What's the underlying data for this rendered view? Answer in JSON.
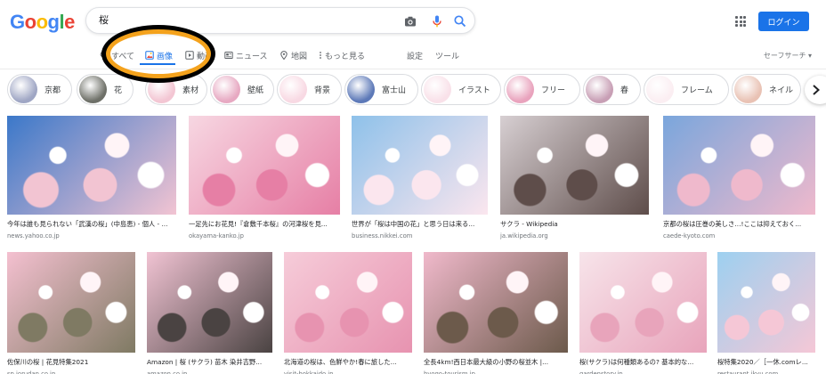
{
  "logo": {
    "letters": [
      "G",
      "o",
      "o",
      "g",
      "l",
      "e"
    ],
    "colors": [
      "#4285f4",
      "#ea4335",
      "#fbbc05",
      "#4285f4",
      "#34a853",
      "#ea4335"
    ]
  },
  "search": {
    "query": "桜"
  },
  "header": {
    "login_label": "ログイン"
  },
  "tabs": [
    {
      "label": "すべて",
      "icon": "search-icon"
    },
    {
      "label": "画像",
      "icon": "image-icon",
      "active": true
    },
    {
      "label": "動画",
      "icon": "video-icon"
    },
    {
      "label": "ニュース",
      "icon": "news-icon"
    },
    {
      "label": "地図",
      "icon": "map-pin-icon"
    },
    {
      "label": "もっと見る",
      "icon": "more-icon"
    },
    {
      "label": "設定"
    },
    {
      "label": "ツール"
    }
  ],
  "safe_search": "セーフサーチ ▾",
  "chips": [
    {
      "label": "京都",
      "thumb": "#9fa6c4"
    },
    {
      "label": "花",
      "thumb": "#6e7068"
    },
    {
      "label": "素材",
      "thumb": "#f3c6d3"
    },
    {
      "label": "壁紙",
      "thumb": "#e7a9c2"
    },
    {
      "label": "背景",
      "thumb": "#f8d9e3"
    },
    {
      "label": "富士山",
      "thumb": "#5d79b8"
    },
    {
      "label": "イラスト",
      "thumb": "#f9e1e9"
    },
    {
      "label": "フリー",
      "thumb": "#e9a3bd"
    },
    {
      "label": "春",
      "thumb": "#c89fb5"
    },
    {
      "label": "フレーム",
      "thumb": "#fbeef2"
    },
    {
      "label": "ネイル",
      "thumb": "#e9c2b4"
    }
  ],
  "results": [
    {
      "title": "今年は誰も見られない「武漢の桜」(中島恵) - 個人 - ...",
      "source": "news.yahoo.co.jp",
      "colors": [
        "#3b78c9",
        "#f2c4d2"
      ]
    },
    {
      "title": "一足先にお花見!『倉敷千本桜』の河津桜を見...",
      "source": "okayama-kanko.jp",
      "colors": [
        "#f7d7e2",
        "#e67fa5"
      ]
    },
    {
      "title": "世界が「桜は中国の花」と思う日は来る...",
      "source": "business.nikkei.com",
      "colors": [
        "#8ec1ea",
        "#fbe6ee"
      ]
    },
    {
      "title": "サクラ - Wikipedia",
      "source": "ja.wikipedia.org",
      "colors": [
        "#d7cfd2",
        "#5e4d4a"
      ]
    },
    {
      "title": "京都の桜は圧巻の美しさ…!ここは抑えておく...",
      "source": "caede-kyoto.com",
      "colors": [
        "#7aa6dc",
        "#efb9cc"
      ]
    },
    {
      "title": "佐保川の桜 | 花見特集2021",
      "source": "sp.jorudan.co.jp",
      "colors": [
        "#f4c0d0",
        "#7f7a63"
      ]
    },
    {
      "title": "Amazon | 桜 (サクラ) 苗木 染井吉野...",
      "source": "amazon.co.jp",
      "colors": [
        "#f1c3d3",
        "#4a4342"
      ]
    },
    {
      "title": "北海道の桜は、色鮮やか!春に旅した...",
      "source": "visit-hokkaido.jp",
      "colors": [
        "#f6ccd9",
        "#e793b0"
      ]
    },
    {
      "title": "全長4km!西日本最大級の小野の桜並木 |...",
      "source": "hyogo-tourism.jp",
      "colors": [
        "#f0b9cb",
        "#6c5a4b"
      ]
    },
    {
      "title": "桜(サクラ)は何種類あるの? 基本的な...",
      "source": "gardenstory.jp",
      "colors": [
        "#f7e4ea",
        "#e8a4bb"
      ]
    },
    {
      "title": "桜特集2020／［一休.comレ...",
      "source": "restaurant.ikyu.com",
      "colors": [
        "#9dd0f0",
        "#f5c7d6"
      ]
    }
  ]
}
